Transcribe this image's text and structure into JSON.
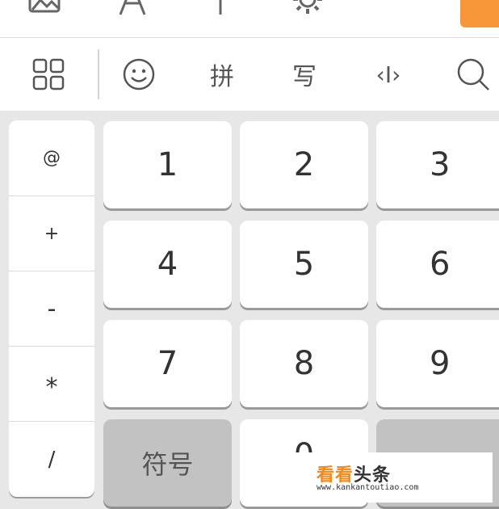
{
  "top_toolbar": {
    "icons": [
      "image-icon",
      "font-icon",
      "cursor-move-icon",
      "gear-icon"
    ]
  },
  "ime_toolbar": {
    "items": [
      {
        "name": "grid-menu-icon"
      },
      {
        "name": "emoji-icon"
      },
      {
        "name": "pinyin",
        "label": "拼"
      },
      {
        "name": "handwriting",
        "label": "写"
      },
      {
        "name": "cursor-edit-icon",
        "label": "‹I›"
      },
      {
        "name": "search-icon"
      }
    ]
  },
  "keyboard": {
    "symbols": [
      "@",
      "+",
      "-",
      "*",
      "/"
    ],
    "rows": [
      [
        "1",
        "2",
        "3"
      ],
      [
        "4",
        "5",
        "6"
      ],
      [
        "7",
        "8",
        "9"
      ],
      [
        "符号",
        "0",
        ""
      ]
    ]
  },
  "watermark": {
    "kan1": "看",
    "kan2": "看",
    "toutiao": "头条",
    "url": "www.kankantoutiao.com"
  },
  "colors": {
    "accent_orange": "#f8973a",
    "keyboard_bg": "#e7e7e7",
    "key_bg": "#ffffff",
    "function_key_bg": "#c2c2c2"
  }
}
